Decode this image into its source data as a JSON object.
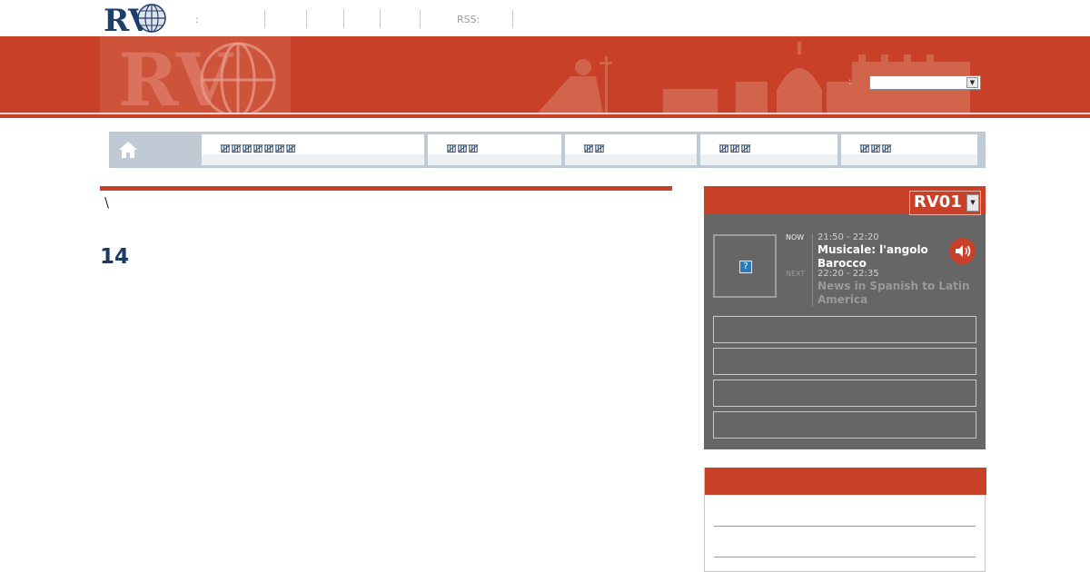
{
  "site": {
    "logo_text": "RV",
    "top_nav": {
      "lang_label": ":",
      "rss_label": "RSS:"
    }
  },
  "search": {
    "label": ":",
    "value": ""
  },
  "main_nav": {
    "items": [
      {
        "label": "ꯀꯀꯀꯀꯀꯀꯀ"
      },
      {
        "label": "ꯀꯀꯀ"
      },
      {
        "label": "ꯀꯀ"
      },
      {
        "label": "ꯀꯀꯀ"
      },
      {
        "label": "ꯀꯀꯀ"
      }
    ]
  },
  "content": {
    "breadcrumb": "\\",
    "page_number": "14"
  },
  "radio": {
    "channel": "RV01",
    "now_label": "NOW",
    "next_label": "NEXT",
    "now_time": "21:50 - 22:20",
    "now_title": "Musicale: l'angolo Barocco",
    "next_time": "22:20 - 22:35",
    "next_title": "News in Spanish to Latin America",
    "thumbnail_placeholder": "?"
  },
  "colors": {
    "brand_red": "#c84027",
    "nav_blue": "#2b4a6b",
    "panel_gray": "#666666"
  }
}
